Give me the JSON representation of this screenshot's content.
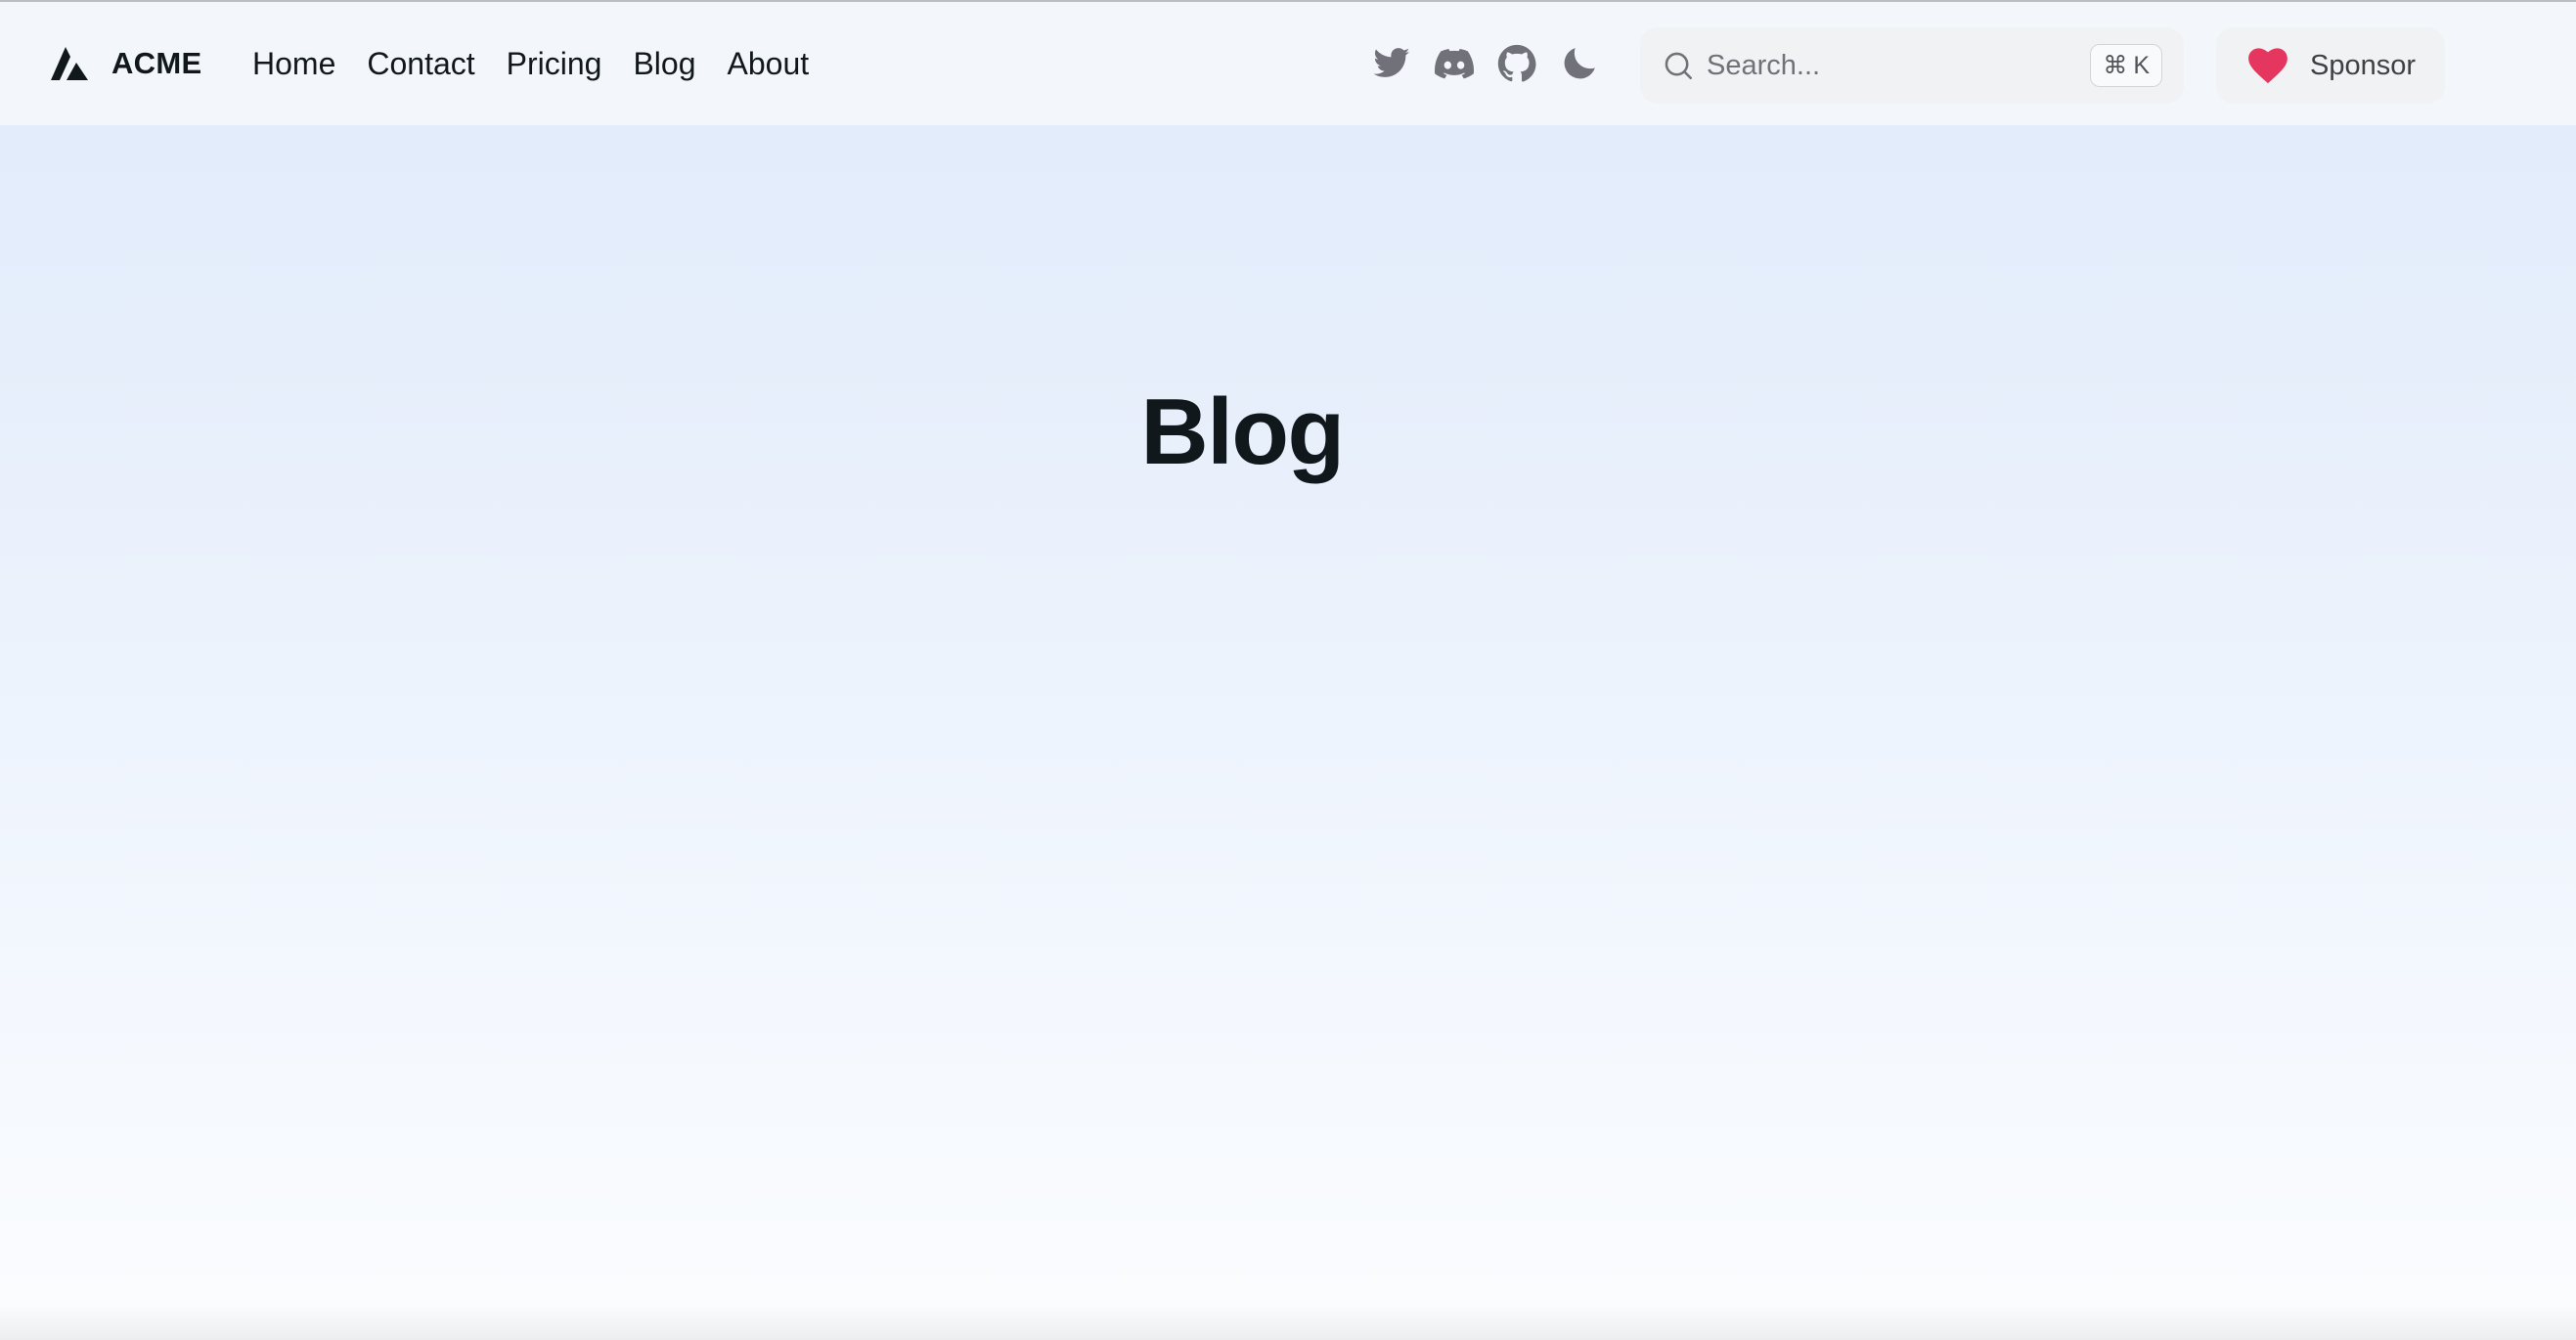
{
  "brand": {
    "name": "ACME"
  },
  "nav": {
    "links": [
      "Home",
      "Contact",
      "Pricing",
      "Blog",
      "About"
    ]
  },
  "icons": {
    "twitter": "twitter-icon",
    "discord": "discord-icon",
    "github": "github-icon",
    "theme": "moon-icon"
  },
  "search": {
    "placeholder": "Search...",
    "shortcut_symbol": "⌘",
    "shortcut_key": "K"
  },
  "sponsor": {
    "label": "Sponsor",
    "heart_color": "#e5365f"
  },
  "main": {
    "title": "Blog"
  }
}
